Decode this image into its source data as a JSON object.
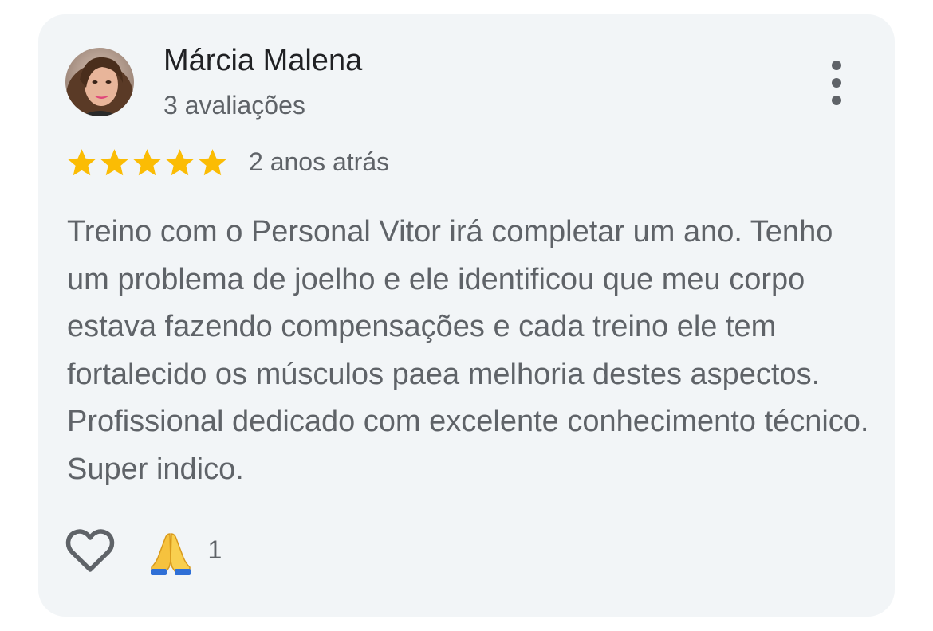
{
  "review": {
    "author_name": "Márcia Malena",
    "author_reviews": "3 avaliações",
    "rating": 5,
    "rating_max": 5,
    "time_ago": "2 anos atrás",
    "text": "Treino com o Personal Vitor irá completar um ano. Tenho um problema de joelho e ele identificou que meu corpo estava fazendo compensações e cada treino ele tem fortalecido os músculos paea melhoria destes aspectos. Profissional dedicado com excelente conhecimento técnico. Super indico.",
    "reaction_emoji": "folded-hands",
    "reaction_count": "1"
  },
  "icons": {
    "more": "more-vertical-icon",
    "like": "heart-outline-icon",
    "star": "star-icon"
  },
  "colors": {
    "card_bg": "#f2f5f7",
    "star": "#fbbc04",
    "title_text": "#202124",
    "secondary_text": "#5f6368"
  }
}
